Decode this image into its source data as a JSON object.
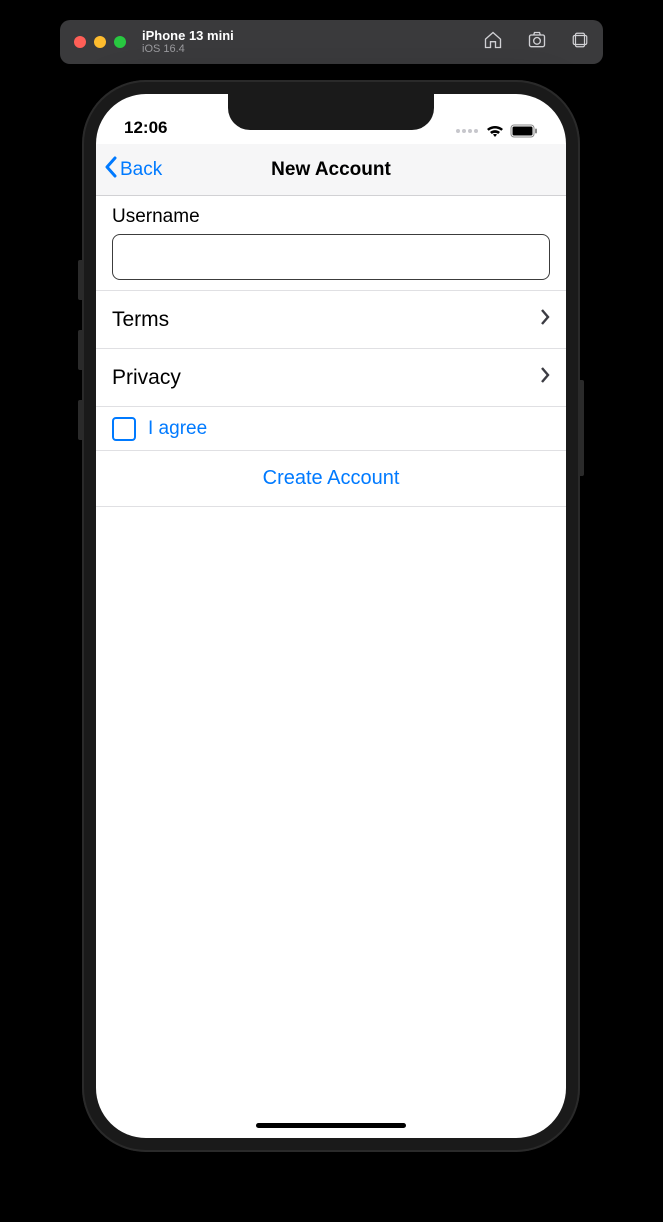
{
  "simulator": {
    "device_name": "iPhone 13 mini",
    "os_version": "iOS 16.4"
  },
  "status_bar": {
    "time": "12:06"
  },
  "nav": {
    "back_label": "Back",
    "title": "New Account"
  },
  "form": {
    "username_label": "Username",
    "username_value": "",
    "rows": {
      "terms_label": "Terms",
      "privacy_label": "Privacy"
    },
    "agree_label": "I agree",
    "agree_checked": false,
    "create_label": "Create Account"
  },
  "colors": {
    "accent": "#007aff",
    "separator": "#e0e0e3",
    "navbar_bg": "#f6f6f7"
  }
}
